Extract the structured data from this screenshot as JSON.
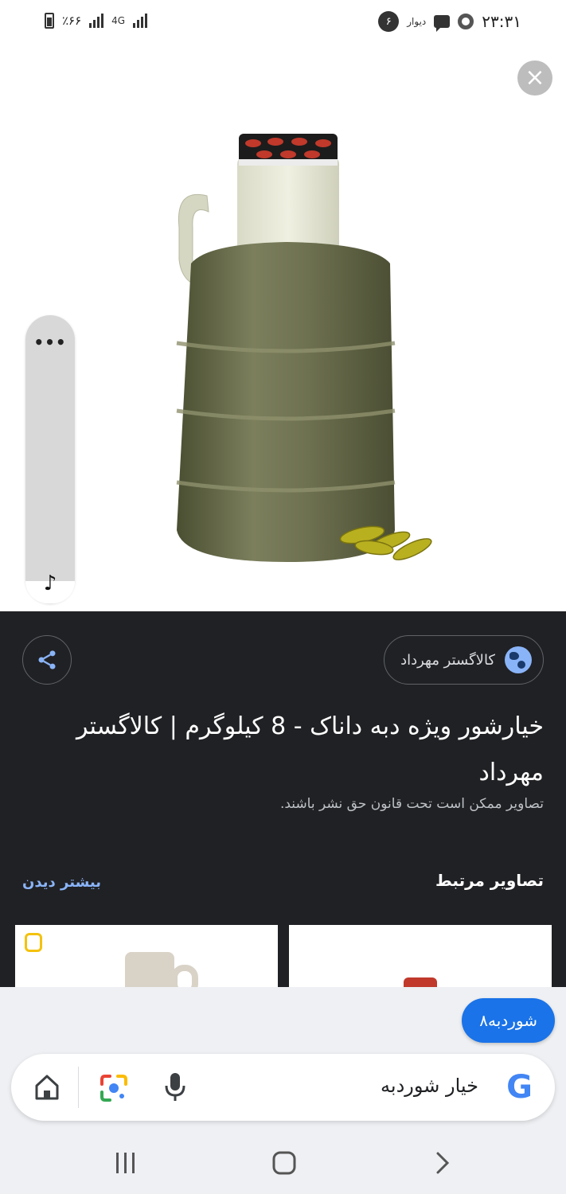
{
  "status_bar": {
    "time": "۲۳:۳۱",
    "battery": "٪۶۶",
    "network": "4G",
    "notification_count": "۶",
    "divar_label": "دیوار"
  },
  "viewer": {
    "close_label": "×",
    "side_panel_dots": "•••",
    "side_panel_music": "♪"
  },
  "info": {
    "source_name": "کالاگستر مهرداد",
    "title": "خیارشور ویژه دبه داناک - 8 کیلوگرم | کالاگستر مهرداد",
    "copyright_notice": "تصاویر ممکن است تحت قانون حق نشر باشند.",
    "related_heading": "تصاویر مرتبط",
    "see_more": "بیشتر دیدن"
  },
  "search": {
    "suggestion_chip": "شوردبه۸",
    "query": "خیار شوردبه",
    "google_logo": "G"
  },
  "colors": {
    "accent_blue": "#1a73e8",
    "dark_panel": "#202124",
    "link_blue": "#8ab4f8"
  },
  "icons": [
    "battery-icon",
    "signal-icon",
    "message-icon",
    "close-icon",
    "share-icon",
    "globe-icon",
    "home-icon",
    "lens-icon",
    "mic-icon",
    "recents-icon",
    "nav-home-icon",
    "back-icon"
  ]
}
